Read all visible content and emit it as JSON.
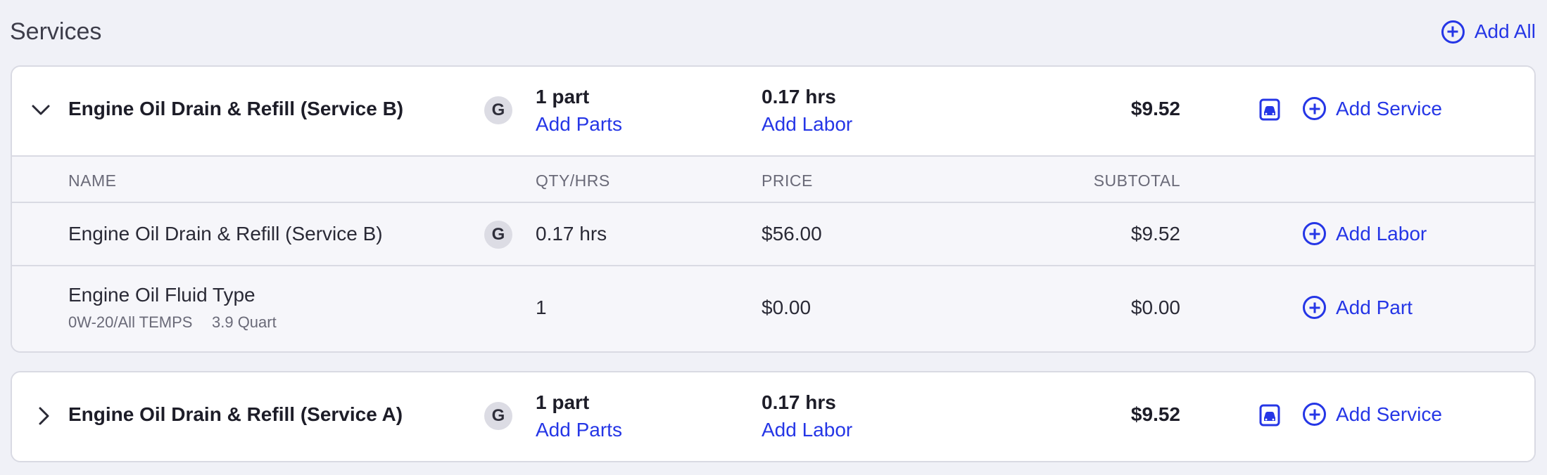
{
  "header": {
    "title": "Services",
    "add_all_label": "Add All"
  },
  "services": [
    {
      "name": "Engine Oil Drain & Refill (Service B)",
      "badge": "G",
      "parts_count": "1 part",
      "add_parts_label": "Add Parts",
      "hours": "0.17 hrs",
      "add_labor_label": "Add Labor",
      "total": "$9.52",
      "add_service_label": "Add Service",
      "expanded": true,
      "table": {
        "columns": [
          "NAME",
          "QTY/HRS",
          "PRICE",
          "SUBTOTAL"
        ],
        "rows": [
          {
            "name": "Engine Oil Drain & Refill (Service B)",
            "badge": "G",
            "qty": "0.17 hrs",
            "price": "$56.00",
            "subtotal": "$9.52",
            "action_label": "Add Labor"
          },
          {
            "name": "Engine Oil Fluid Type",
            "desc": "0W-20/All TEMPS",
            "desc2": "3.9 Quart",
            "qty": "1",
            "price": "$0.00",
            "subtotal": "$0.00",
            "action_label": "Add Part"
          }
        ]
      }
    },
    {
      "name": "Engine Oil Drain & Refill (Service A)",
      "badge": "G",
      "parts_count": "1 part",
      "add_parts_label": "Add Parts",
      "hours": "0.17 hrs",
      "add_labor_label": "Add Labor",
      "total": "$9.52",
      "add_service_label": "Add Service",
      "expanded": false
    }
  ],
  "icons": {
    "chevron_down": "chevron-down-icon",
    "chevron_right": "chevron-right-icon",
    "add": "plus-circle-icon",
    "vehicle": "car-icon"
  },
  "colors": {
    "accent": "#2536e6",
    "background": "#f0f1f7"
  }
}
